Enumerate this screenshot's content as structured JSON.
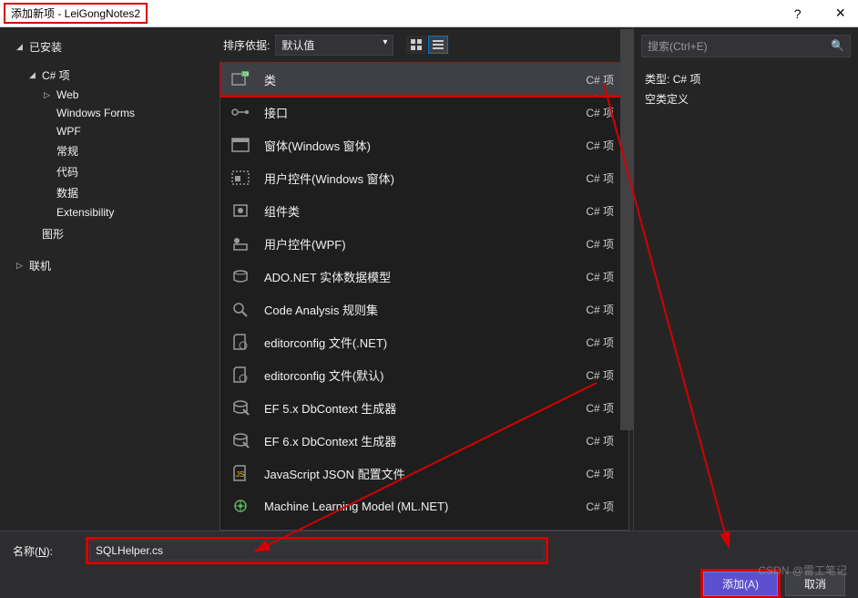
{
  "titlebar": {
    "title": "添加新项 - LeiGongNotes2",
    "help": "?",
    "close": "×"
  },
  "sidebar": {
    "installed": "已安装",
    "csharp": "C# 项",
    "items": [
      "Web",
      "Windows Forms",
      "WPF",
      "常规",
      "代码",
      "数据",
      "Extensibility"
    ],
    "graphic": "图形",
    "online": "联机"
  },
  "toolbar": {
    "sort_label": "排序依据:",
    "sort_value": "默认值"
  },
  "templates": [
    {
      "name": "类",
      "lang": "C# 项",
      "icon": "class"
    },
    {
      "name": "接口",
      "lang": "C# 项",
      "icon": "interface"
    },
    {
      "name": "窗体(Windows 窗体)",
      "lang": "C# 项",
      "icon": "form"
    },
    {
      "name": "用户控件(Windows 窗体)",
      "lang": "C# 项",
      "icon": "usercontrol"
    },
    {
      "name": "组件类",
      "lang": "C# 项",
      "icon": "component"
    },
    {
      "name": "用户控件(WPF)",
      "lang": "C# 项",
      "icon": "wpfuc"
    },
    {
      "name": "ADO.NET 实体数据模型",
      "lang": "C# 项",
      "icon": "ado"
    },
    {
      "name": "Code Analysis 规则集",
      "lang": "C# 项",
      "icon": "analysis"
    },
    {
      "name": "editorconfig 文件(.NET)",
      "lang": "C# 项",
      "icon": "config"
    },
    {
      "name": "editorconfig 文件(默认)",
      "lang": "C# 项",
      "icon": "config"
    },
    {
      "name": "EF 5.x DbContext 生成器",
      "lang": "C# 项",
      "icon": "ef"
    },
    {
      "name": "EF 6.x DbContext 生成器",
      "lang": "C# 项",
      "icon": "ef"
    },
    {
      "name": "JavaScript JSON 配置文件",
      "lang": "C# 项",
      "icon": "json"
    },
    {
      "name": "Machine Learning Model (ML.NET)",
      "lang": "C# 项",
      "icon": "ml"
    }
  ],
  "right": {
    "search_placeholder": "搜索(Ctrl+E)",
    "type_label": "类型:",
    "type_value": "C# 项",
    "description": "空类定义"
  },
  "bottom": {
    "name_label_pre": "名称(",
    "name_label_u": "N",
    "name_label_post": "):",
    "name_value": "SQLHelper.cs",
    "add_btn": "添加(A)",
    "cancel_btn": "取消"
  },
  "watermark": "CSDN @雷工笔记"
}
